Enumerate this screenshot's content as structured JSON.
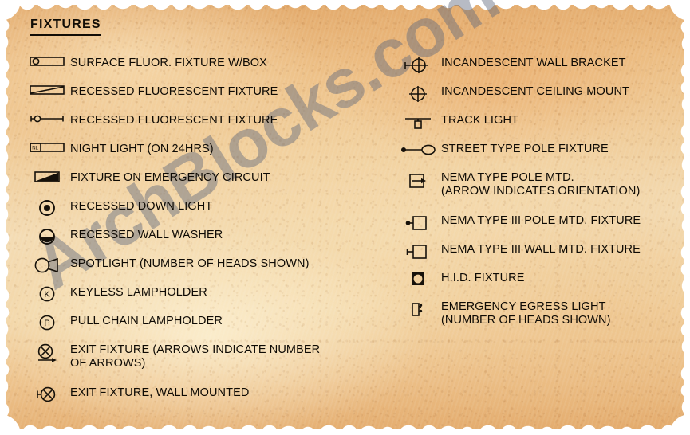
{
  "title": "FIXTURES",
  "watermark": "ArchBlocks.com",
  "colors": {
    "paper_top": "#E2A86A",
    "paper_mid": "#F4DCB4",
    "paper_bottom": "#E3AA6C",
    "ink": "#16110A",
    "watermark": "#5F697D",
    "page_background": "#FFFFFF"
  },
  "left_column": [
    {
      "icon": "surface-fluorescent-fixture-with-box-symbol",
      "label": "SURFACE FLUOR. FIXTURE W/BOX"
    },
    {
      "icon": "recessed-fluorescent-fixture-diagonal-symbol",
      "label": "RECESSED FLUORESCENT FIXTURE"
    },
    {
      "icon": "recessed-fluorescent-fixture-strip-symbol",
      "label": "RECESSED FLUORESCENT FIXTURE"
    },
    {
      "icon": "night-light-symbol",
      "label": "NIGHT LIGHT (ON 24HRS)"
    },
    {
      "icon": "fixture-on-emergency-circuit-symbol",
      "label": "FIXTURE ON EMERGENCY CIRCUIT"
    },
    {
      "icon": "recessed-down-light-symbol",
      "label": "RECESSED DOWN LIGHT"
    },
    {
      "icon": "recessed-wall-washer-symbol",
      "label": "RECESSED WALL WASHER"
    },
    {
      "icon": "spotlight-symbol",
      "label": "SPOTLIGHT (NUMBER OF HEADS SHOWN)"
    },
    {
      "icon": "keyless-lampholder-symbol",
      "label": "KEYLESS LAMPHOLDER"
    },
    {
      "icon": "pull-chain-lampholder-symbol",
      "label": "PULL CHAIN LAMPHOLDER"
    },
    {
      "icon": "exit-fixture-symbol",
      "label": "EXIT FIXTURE (ARROWS INDICATE NUMBER\nOF ARROWS)"
    },
    {
      "icon": "exit-fixture-wall-mounted-symbol",
      "label": "EXIT FIXTURE, WALL MOUNTED"
    }
  ],
  "right_column": [
    {
      "icon": "incandescent-wall-bracket-symbol",
      "label": "INCANDESCENT WALL BRACKET"
    },
    {
      "icon": "incandescent-ceiling-mount-symbol",
      "label": "INCANDESCENT CEILING MOUNT"
    },
    {
      "icon": "track-light-symbol",
      "label": "TRACK LIGHT"
    },
    {
      "icon": "street-type-pole-fixture-symbol",
      "label": "STREET TYPE POLE FIXTURE"
    },
    {
      "icon": "nema-type-pole-mounted-symbol",
      "label": "NEMA TYPE POLE MTD.\n(ARROW INDICATES ORIENTATION)"
    },
    {
      "icon": "nema-type-iii-pole-mounted-fixture-symbol",
      "label": "NEMA TYPE III POLE MTD. FIXTURE"
    },
    {
      "icon": "nema-type-iii-wall-mounted-fixture-symbol",
      "label": "NEMA TYPE III WALL MTD. FIXTURE"
    },
    {
      "icon": "hid-fixture-symbol",
      "label": "H.I.D. FIXTURE"
    },
    {
      "icon": "emergency-egress-light-symbol",
      "label": "EMERGENCY EGRESS LIGHT\n(NUMBER OF HEADS SHOWN)"
    }
  ],
  "symbol_annotations": {
    "night_light_text": "NL"
  }
}
